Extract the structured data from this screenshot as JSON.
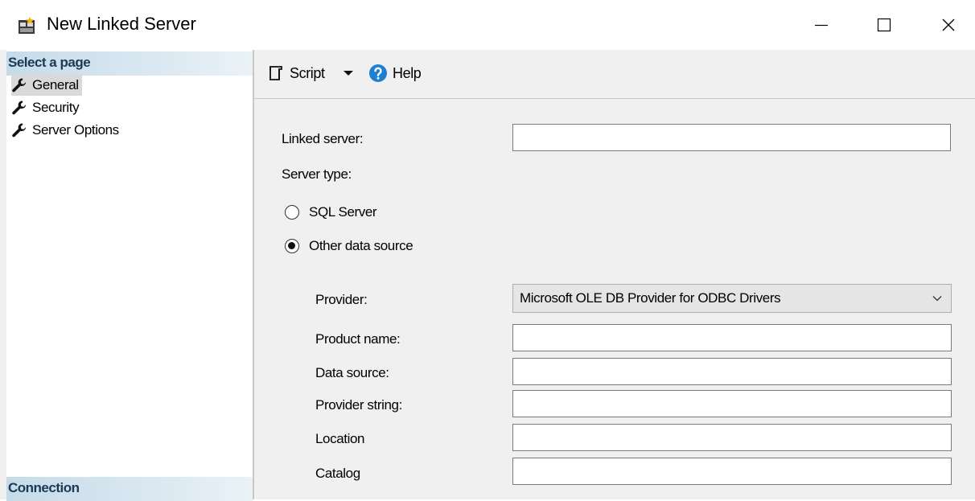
{
  "window": {
    "title": "New Linked Server",
    "controls": [
      "minimize-icon",
      "maximize-icon",
      "close-icon"
    ]
  },
  "sidebar": {
    "select_header": "Select a page",
    "items": [
      {
        "label": "General",
        "icon": "wrench-icon",
        "selected": true
      },
      {
        "label": "Security",
        "icon": "wrench-icon",
        "selected": false
      },
      {
        "label": "Server Options",
        "icon": "wrench-icon",
        "selected": false
      }
    ],
    "connection_header": "Connection"
  },
  "toolbar": {
    "script_label": "Script",
    "script_icon": "script-icon",
    "dropdown_icon": "dropdown-arrow-icon",
    "help_label": "Help",
    "help_icon": "help-icon"
  },
  "form": {
    "linked_server_label": "Linked server:",
    "linked_server_value": "",
    "server_type_label": "Server type:",
    "radio_sql_label": "SQL Server",
    "radio_other_label": "Other data source",
    "selected_server_type": "Other data source",
    "provider_label": "Provider:",
    "provider_value": "Microsoft OLE DB Provider for ODBC Drivers",
    "product_name_label": "Product name:",
    "product_name_value": "",
    "data_source_label": "Data source:",
    "data_source_value": "",
    "provider_string_label": "Provider string:",
    "provider_string_value": "",
    "location_label": "Location",
    "location_value": "",
    "catalog_label": "Catalog",
    "catalog_value": ""
  },
  "colors": {
    "section_header": "#c6dbe9",
    "section_header_text": "#1b3a57",
    "selected_item": "#d9d9d9",
    "help_icon": "#1f7fd1",
    "background": "#f0f0f0"
  }
}
